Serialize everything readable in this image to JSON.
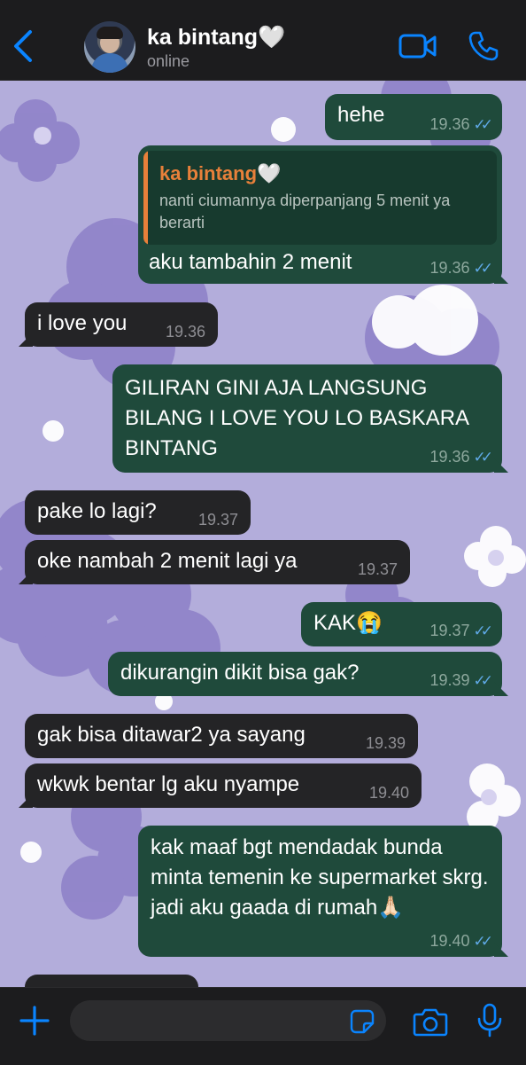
{
  "header": {
    "contact_name": "ka bintang🤍",
    "status": "online"
  },
  "messages": [
    {
      "dir": "out",
      "text": "hehe",
      "time": "19.36",
      "ticks": "✓✓"
    },
    {
      "dir": "out",
      "quote_name": "ka bintang🤍",
      "quote_text": "nanti ciumannya diperpanjang 5 menit ya berarti",
      "text": "aku tambahin 2 menit",
      "time": "19.36",
      "ticks": "✓✓"
    },
    {
      "dir": "in",
      "text": "i love you",
      "time": "19.36"
    },
    {
      "dir": "out",
      "text": "GILIRAN GINI AJA LANGSUNG BILANG I LOVE YOU LO BASKARA BINTANG",
      "time": "19.36",
      "ticks": "✓✓"
    },
    {
      "dir": "in",
      "text": "pake lo lagi?",
      "time": "19.37"
    },
    {
      "dir": "in",
      "text": "oke nambah 2 menit lagi ya",
      "time": "19.37"
    },
    {
      "dir": "out",
      "text": "KAK😭",
      "time": "19.37",
      "ticks": "✓✓"
    },
    {
      "dir": "out",
      "text": "dikurangin dikit bisa gak?",
      "time": "19.39",
      "ticks": "✓✓"
    },
    {
      "dir": "in",
      "text": "gak bisa ditawar2 ya sayang",
      "time": "19.39"
    },
    {
      "dir": "in",
      "text": "wkwk bentar lg aku nyampe",
      "time": "19.40"
    },
    {
      "dir": "out",
      "text": "kak maaf bgt mendadak bunda minta temenin ke supermarket skrg. jadi aku gaada di rumah🙏🏻",
      "time": "19.40",
      "ticks": "✓✓"
    }
  ],
  "composer": {
    "placeholder": ""
  },
  "icons": {
    "back": "chevron-left-icon",
    "video": "video-camera-icon",
    "call": "phone-icon",
    "plus": "plus-icon",
    "sticker": "sticker-icon",
    "camera": "camera-icon",
    "mic": "microphone-icon"
  },
  "colors": {
    "accent": "#0a84ff",
    "outgoing_bubble": "#1f4a3b",
    "incoming_bubble": "#242426",
    "read_ticks": "#5fa9e6",
    "quote_name": "#e8803a",
    "wallpaper": "#b3addb"
  }
}
